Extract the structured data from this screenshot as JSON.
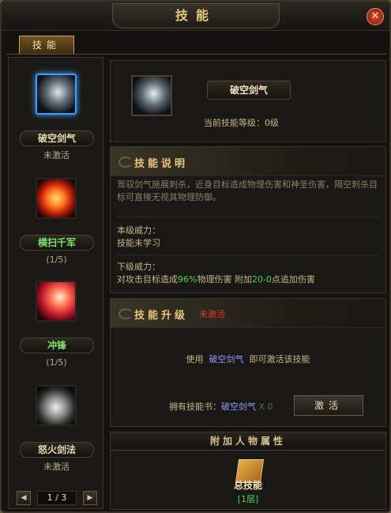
{
  "window": {
    "title": "技能",
    "close_icon": "close-icon"
  },
  "tabs": [
    {
      "label": "技能",
      "active": true
    }
  ],
  "skills": [
    {
      "name": "破空剑气",
      "status": "未激活",
      "icon": "sword-slash-icon",
      "selected": true,
      "name_color": "#e8d8b0"
    },
    {
      "name": "横扫千军",
      "status": "(1/5)",
      "icon": "fire-sweep-icon",
      "selected": false,
      "name_color": "#7fe06a"
    },
    {
      "name": "冲锋",
      "status": "(1/5)",
      "icon": "charge-icon",
      "selected": false,
      "name_color": "#7fe06a"
    },
    {
      "name": "怒火剑法",
      "status": "未激活",
      "icon": "rage-sword-icon",
      "selected": false,
      "name_color": "#e8d8b0"
    }
  ],
  "pager": {
    "text": "1 / 3",
    "prev": "◀",
    "next": "▶"
  },
  "detail": {
    "name": "破空剑气",
    "level_label": "当前技能等级：0级"
  },
  "description": {
    "title": "技能说明",
    "text": "驾驭剑气施展刺杀，近身目标造成物理伤害和神圣伤害，隔空刺杀目标可直接无视其物理防御。",
    "cur_label": "本级威力：",
    "cur_text": "技能未学习",
    "next_label": "下级威力：",
    "next_pre": "对攻击目标造成",
    "next_val1": "96%",
    "next_mid": "物理伤害 附加",
    "next_val2": "20-0",
    "next_post": "点追加伤害"
  },
  "upgrade": {
    "title": "技能升级",
    "status": "未激活",
    "use_pre": "使用",
    "use_skill": "破空剑气",
    "use_post": "即可激活该技能",
    "book_label": "拥有技能书：",
    "book_name": "破空剑气",
    "book_count": "X 0",
    "activate_button": "激活"
  },
  "attributes": {
    "title": "附加人物属性",
    "total_label": "总技能",
    "layer": "[1层]",
    "book_icon": "skill-book-icon"
  }
}
